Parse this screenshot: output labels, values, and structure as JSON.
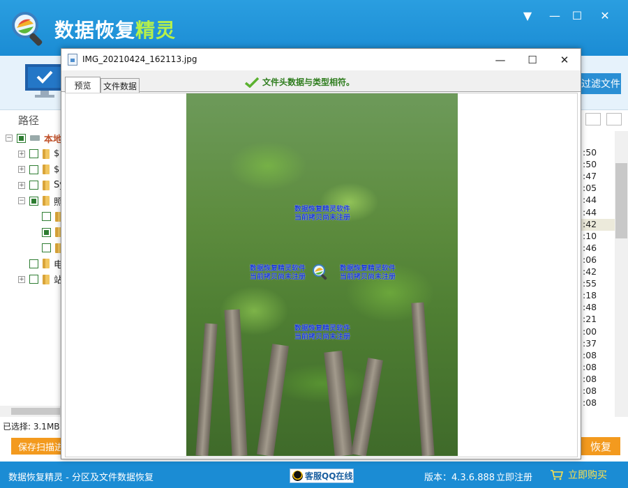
{
  "app": {
    "title_main": "数据恢复",
    "title_accent": "精灵",
    "filter_button": "过滤文件",
    "path_header": "路径",
    "tree": [
      {
        "label": "本地",
        "level": 0,
        "checked": "partial",
        "expander": "−"
      },
      {
        "label": "$",
        "level": 1,
        "checked": "none",
        "expander": "+"
      },
      {
        "label": "$",
        "level": 1,
        "checked": "none",
        "expander": "+"
      },
      {
        "label": "Sy",
        "level": 1,
        "checked": "none",
        "expander": "+"
      },
      {
        "label": "照",
        "level": 1,
        "checked": "partial",
        "expander": "−"
      },
      {
        "label": "",
        "level": 2,
        "checked": "none",
        "expander": ""
      },
      {
        "label": "",
        "level": 2,
        "checked": "partial",
        "expander": ""
      },
      {
        "label": "",
        "level": 2,
        "checked": "none",
        "expander": ""
      },
      {
        "label": "电",
        "level": 1,
        "checked": "none",
        "expander": ""
      },
      {
        "label": "站",
        "level": 1,
        "checked": "none",
        "expander": "+"
      }
    ],
    "time_column": [
      ":50",
      ":50",
      ":47",
      ":05",
      ":44",
      ":44",
      ":42",
      ":10",
      ":46",
      ":06",
      ":42",
      ":55",
      ":18",
      ":48",
      ":21",
      ":00",
      ":37",
      ":08",
      ":08",
      ":08",
      ":08",
      ":08"
    ],
    "highlighted_row": 6,
    "selected_status": "已选择: 3.1MB",
    "save_scan_button": "保存扫描进度",
    "recover_button": "恢复"
  },
  "footer": {
    "title": "数据恢复精灵 - 分区及文件数据恢复",
    "qq_button": "客服QQ在线",
    "version": "版本：4.3.6.888",
    "register": "立即注册",
    "buy": "立即购买"
  },
  "dialog": {
    "title": "IMG_20210424_162113.jpg",
    "tabs": [
      "预览",
      "文件数据"
    ],
    "active_tab": 0,
    "match_message": "文件头数据与类型相符。",
    "watermark_line1": "数据恢复精灵软件",
    "watermark_line2": "当前拷贝尚未注册"
  },
  "colors": {
    "brand_blue": "#1b8cd4",
    "accent_orange": "#f39a1e",
    "accent_green": "#b6f04a",
    "watermark_blue": "#1a3ad6"
  },
  "icons": {
    "logo": "magnifier-logo-icon",
    "monitor": "monitor-check-icon",
    "check": "green-check-icon",
    "qq": "qq-penguin-icon",
    "cart": "shopping-cart-icon"
  }
}
